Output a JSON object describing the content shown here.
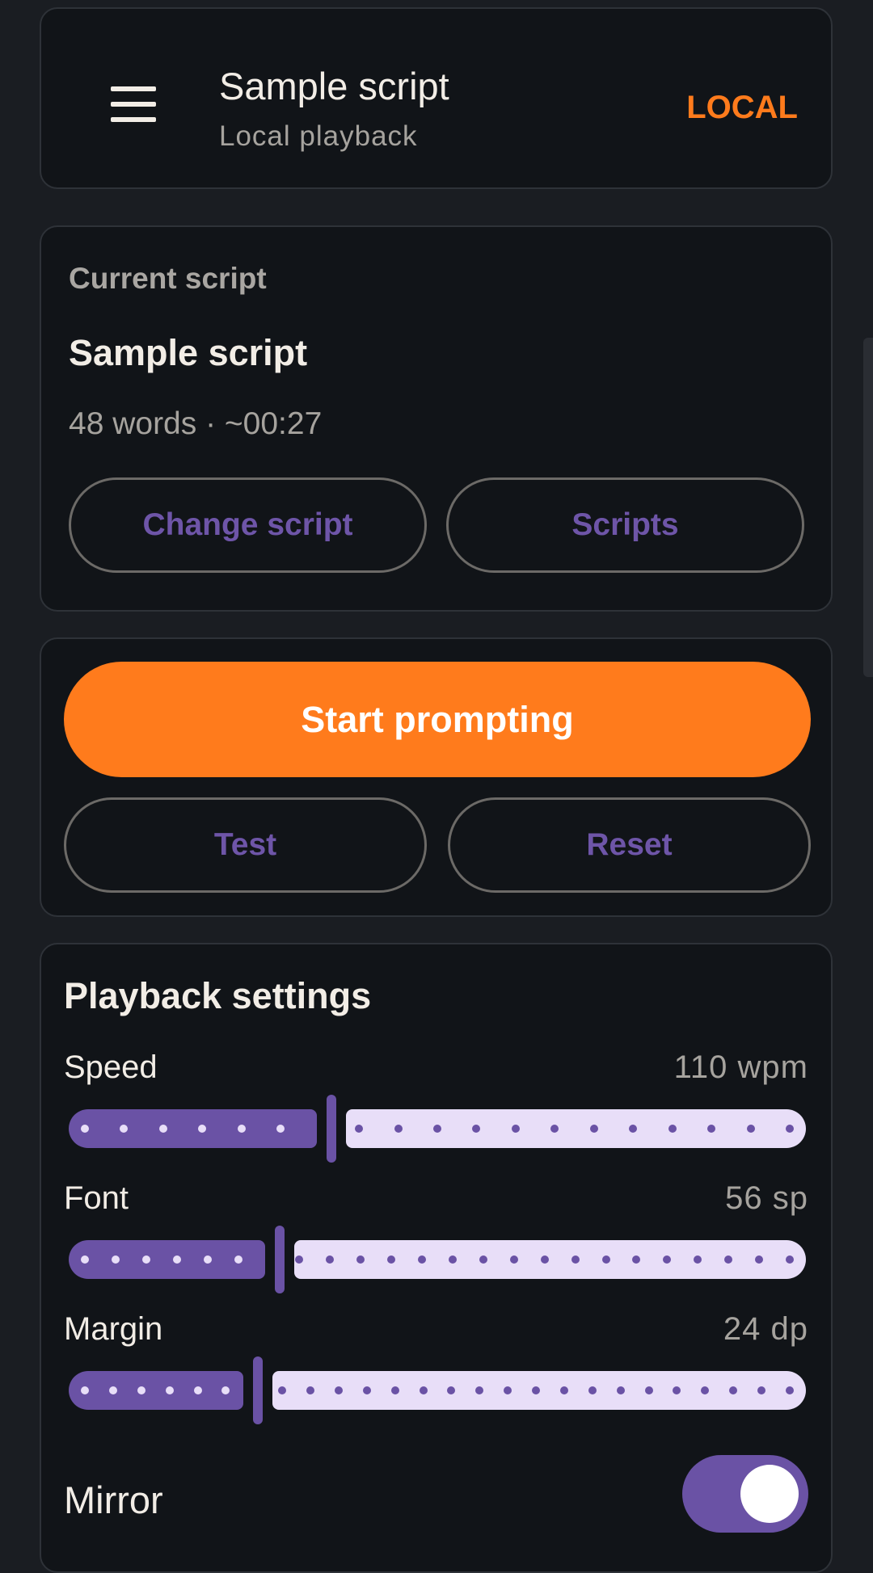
{
  "header": {
    "menu_icon": "menu-icon",
    "title": "Sample script",
    "subtitle": "Local playback",
    "badge": "LOCAL"
  },
  "current_script": {
    "section_label": "Current script",
    "title": "Sample script",
    "meta": "48 words · ~00:27",
    "change_button": "Change script",
    "scripts_button": "Scripts"
  },
  "actions": {
    "start_button": "Start prompting",
    "test_button": "Test",
    "reset_button": "Reset"
  },
  "playback": {
    "title": "Playback settings",
    "speed": {
      "label": "Speed",
      "value": "110 wpm",
      "level": 0.35,
      "steps": 18
    },
    "font": {
      "label": "Font",
      "value": "56 sp",
      "level": 0.28,
      "steps": 23
    },
    "margin": {
      "label": "Margin",
      "value": "24 dp",
      "level": 0.25,
      "steps": 25
    },
    "mirror": {
      "label": "Mirror",
      "on": true
    }
  },
  "colors": {
    "accent": "#ff7b1c",
    "slider_active": "#6a52a5",
    "slider_inactive": "#e8def8",
    "button_text": "#6e55a8"
  }
}
